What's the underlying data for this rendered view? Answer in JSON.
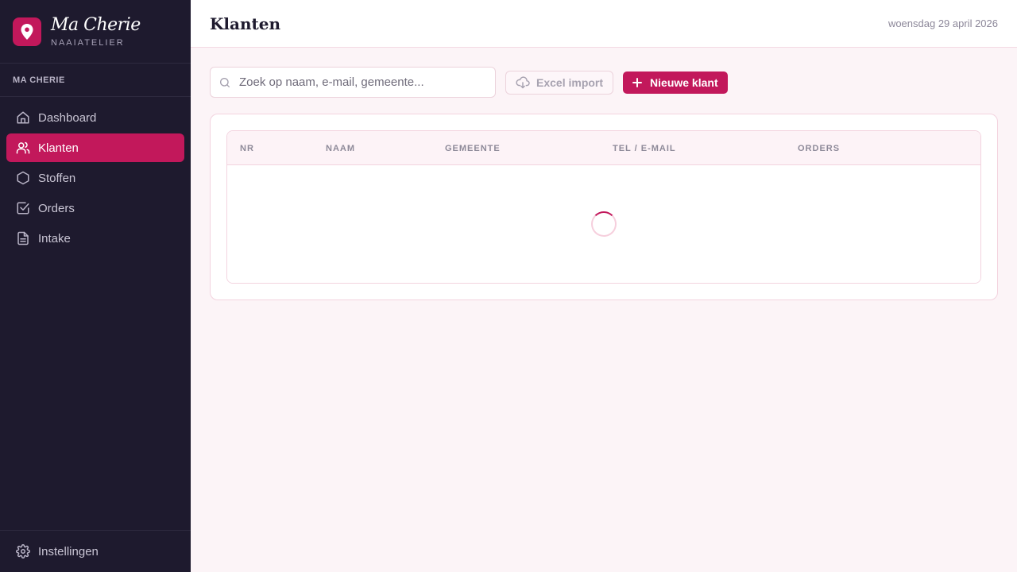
{
  "brand": {
    "name": "Ma Cherie",
    "subtitle": "NAAIATELIER"
  },
  "sidebar": {
    "section_label": "MA CHERIE",
    "items": [
      {
        "label": "Dashboard",
        "icon": "home-icon",
        "active": false
      },
      {
        "label": "Klanten",
        "icon": "users-icon",
        "active": true
      },
      {
        "label": "Stoffen",
        "icon": "hexagon-icon",
        "active": false
      },
      {
        "label": "Orders",
        "icon": "check-square-icon",
        "active": false
      },
      {
        "label": "Intake",
        "icon": "file-text-icon",
        "active": false
      }
    ],
    "footer": {
      "label": "Instellingen",
      "icon": "gear-icon"
    }
  },
  "header": {
    "title": "Klanten",
    "date": "woensdag 29 april 2026"
  },
  "toolbar": {
    "search_placeholder": "Zoek op naam, e-mail, gemeente...",
    "search_value": "",
    "import_label": "Excel import",
    "new_label": "Nieuwe klant"
  },
  "table": {
    "columns": [
      "NR",
      "NAAM",
      "GEMEENTE",
      "TEL / E-MAIL",
      "ORDERS"
    ],
    "rows": [],
    "loading": true
  },
  "colors": {
    "accent": "#c2185b",
    "sidebar_bg": "#1e1a2e",
    "page_bg": "#fcf4f7"
  }
}
